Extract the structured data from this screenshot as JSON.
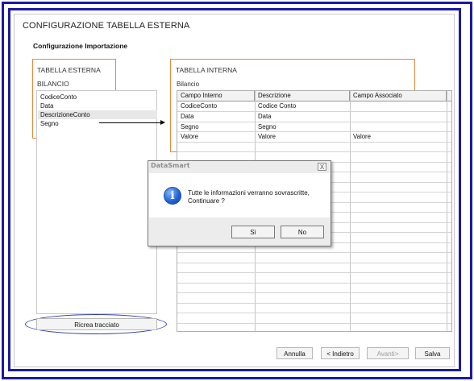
{
  "window": {
    "title": "CONFIGURAZIONE TABELLA ESTERNA",
    "subtitle": "Configurazione Importazione"
  },
  "external": {
    "section_label": "TABELLA ESTERNA",
    "table_name": "BILANCIO",
    "fields": [
      "CodiceConto",
      "Data",
      "DescrizioneConto",
      "Segno"
    ],
    "selected_index": 2
  },
  "internal": {
    "section_label": "TABELLA INTERNA",
    "table_name": "Bilancio",
    "columns": [
      "Campo Interno",
      "Descrizione",
      "Campo Associato"
    ],
    "rows": [
      [
        "CodiceConto",
        "Codice Conto",
        ""
      ],
      [
        "Data",
        "Data",
        ""
      ],
      [
        "Segno",
        "Segno",
        ""
      ],
      [
        "Valore",
        "Valore",
        "Valore"
      ]
    ]
  },
  "buttons": {
    "ricrea": "Ricrea tracciato",
    "annulla": "Annulla",
    "indietro": "< Indietro",
    "avanti": "Avanti>",
    "salva": "Salva"
  },
  "dialog": {
    "title": "DataSmart",
    "close_glyph": "X",
    "icon": "info-icon",
    "message_line1": "Tutte le informazioni verranno sovrascritte,",
    "message_line2": "Continuare ?",
    "yes": "Sì",
    "no": "No"
  },
  "colors": {
    "frame": "#1a1aa8",
    "highlight_box": "#e08a3a",
    "ellipse": "#2a3aa8"
  }
}
